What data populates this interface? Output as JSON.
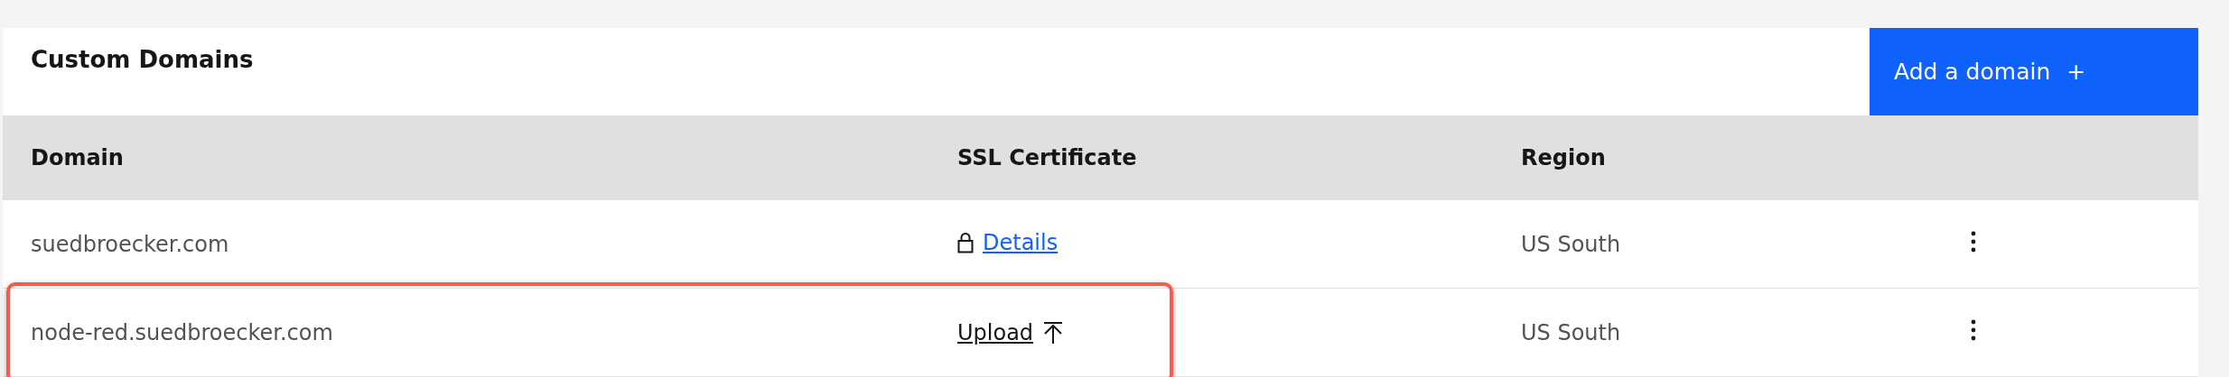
{
  "panel": {
    "title": "Custom Domains",
    "add_button": {
      "label": "Add a domain",
      "icon": "+"
    }
  },
  "table": {
    "columns": [
      "Domain",
      "SSL Certificate",
      "Region"
    ],
    "rows": [
      {
        "domain": "suedbroecker.com",
        "ssl": {
          "kind": "details",
          "label": "Details"
        },
        "region": "US South",
        "highlighted": false
      },
      {
        "domain": "node-red.suedbroecker.com",
        "ssl": {
          "kind": "upload",
          "label": "Upload"
        },
        "region": "US South",
        "highlighted": true
      }
    ]
  }
}
